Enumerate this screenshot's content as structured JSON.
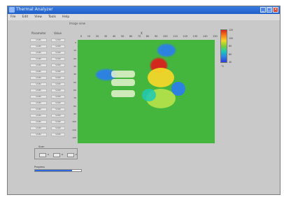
{
  "window": {
    "title": "Thermal Analyzer",
    "accent": "#2a6ed8"
  },
  "menu": [
    "File",
    "Edit",
    "View",
    "Tools",
    "Help"
  ],
  "subtitle": "Image view",
  "table": {
    "headers": [
      "Parameter",
      "Value"
    ],
    "rows": [
      [
        "0.00",
        "0.00"
      ],
      [
        "0.00",
        "0.00"
      ],
      [
        "0.00",
        "0.00"
      ],
      [
        "0.00",
        "0.00"
      ],
      [
        "0.00",
        "0.00"
      ],
      [
        "0.00",
        "0.00"
      ],
      [
        "0.00",
        "0.00"
      ],
      [
        "0.00",
        "0.00"
      ],
      [
        "0.00",
        "0.00"
      ],
      [
        "0.00",
        "0.00"
      ],
      [
        "0.00",
        "0.00"
      ],
      [
        "0.00",
        "0.00"
      ],
      [
        "0.00",
        "0.00"
      ],
      [
        "0.00",
        "0.00"
      ],
      [
        "0.00",
        "0.00"
      ],
      [
        "0.00",
        "0.00"
      ]
    ]
  },
  "plot": {
    "x_title": "X",
    "x_ticks": [
      "0",
      "10",
      "20",
      "30",
      "40",
      "50",
      "60",
      "70",
      "80",
      "90",
      "100",
      "110",
      "120",
      "130",
      "140",
      "150"
    ],
    "y_ticks": [
      "0",
      "10",
      "20",
      "30",
      "40",
      "50",
      "60",
      "70",
      "80",
      "90",
      "100",
      "110",
      "120"
    ]
  },
  "colorbar": {
    "labels": [
      "120",
      "100",
      "80",
      "60",
      "40"
    ],
    "unit": "°C"
  },
  "controls": {
    "group_title": "Scan",
    "b1": "S",
    "b2": "R",
    "b3": "P",
    "field_label": "Progress",
    "progress": 0.8
  },
  "colors": {
    "plot_bg": "#44b63e",
    "hot": "#d2281e",
    "cool": "#2d82e0"
  }
}
